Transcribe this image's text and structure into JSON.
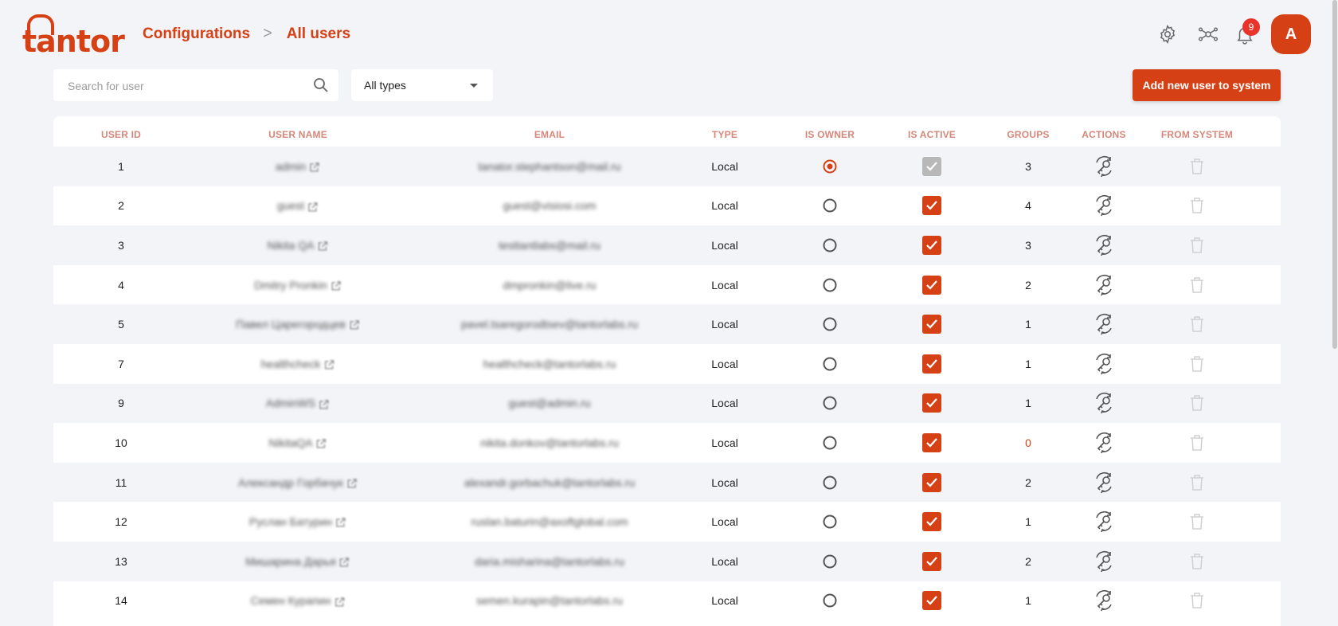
{
  "logo": {
    "text": "tantor"
  },
  "breadcrumb": {
    "parent": "Configurations",
    "separator": ">",
    "current": "All users"
  },
  "header": {
    "icons": [
      "settings-icon",
      "network-icon",
      "bell-icon"
    ],
    "notifications_count": "9",
    "avatar_initial": "A"
  },
  "toolbar": {
    "search_placeholder": "Search for user",
    "type_filter": "All types",
    "add_button_label": "Add new user to system"
  },
  "table": {
    "columns": [
      "USER ID",
      "USER NAME",
      "EMAIL",
      "TYPE",
      "IS OWNER",
      "IS ACTIVE",
      "GROUPS",
      "ACTIONS",
      "FROM SYSTEM"
    ],
    "rows": [
      {
        "id": "1",
        "name": "admin",
        "email": "tanator.stephantson@mail.ru",
        "type": "Local",
        "owner": true,
        "active": "disabled",
        "groups": "3"
      },
      {
        "id": "2",
        "name": "guest",
        "email": "guest@visiosi.com",
        "type": "Local",
        "owner": false,
        "active": "checked",
        "groups": "4"
      },
      {
        "id": "3",
        "name": "Nikita QA",
        "email": "testtantlabs@mail.ru",
        "type": "Local",
        "owner": false,
        "active": "checked",
        "groups": "3"
      },
      {
        "id": "4",
        "name": "Dmitry Pronkin",
        "email": "dmpronkin@live.ru",
        "type": "Local",
        "owner": false,
        "active": "checked",
        "groups": "2"
      },
      {
        "id": "5",
        "name": "Павел Царегородцев",
        "email": "pavel.tsaregorodtsev@tantorlabs.ru",
        "type": "Local",
        "owner": false,
        "active": "checked",
        "groups": "1"
      },
      {
        "id": "7",
        "name": "healthcheck",
        "email": "healthcheck@tantorlabs.ru",
        "type": "Local",
        "owner": false,
        "active": "checked",
        "groups": "1"
      },
      {
        "id": "9",
        "name": "AdminWS",
        "email": "guest@admin.ru",
        "type": "Local",
        "owner": false,
        "active": "checked",
        "groups": "1"
      },
      {
        "id": "10",
        "name": "NikitaQA",
        "email": "nikita.donkov@tantorlabs.ru",
        "type": "Local",
        "owner": false,
        "active": "checked",
        "groups": "0"
      },
      {
        "id": "11",
        "name": "Александр Горбачук",
        "email": "alexandr.gorbachuk@tantorlabs.ru",
        "type": "Local",
        "owner": false,
        "active": "checked",
        "groups": "2"
      },
      {
        "id": "12",
        "name": "Руслан Батурин",
        "email": "ruslan.baturin@axoftglobal.com",
        "type": "Local",
        "owner": false,
        "active": "checked",
        "groups": "1"
      },
      {
        "id": "13",
        "name": "Мишарина Дарья",
        "email": "daria.misharina@tantorlabs.ru",
        "type": "Local",
        "owner": false,
        "active": "checked",
        "groups": "2"
      },
      {
        "id": "14",
        "name": "Семен Курапин",
        "email": "semen.kurapin@tantorlabs.ru",
        "type": "Local",
        "owner": false,
        "active": "checked",
        "groups": "1"
      }
    ]
  },
  "colors": {
    "accent": "#d64015",
    "header_text": "#d6877a",
    "row_alt": "#f3f4f8",
    "disabled": "#b8b8b8"
  }
}
